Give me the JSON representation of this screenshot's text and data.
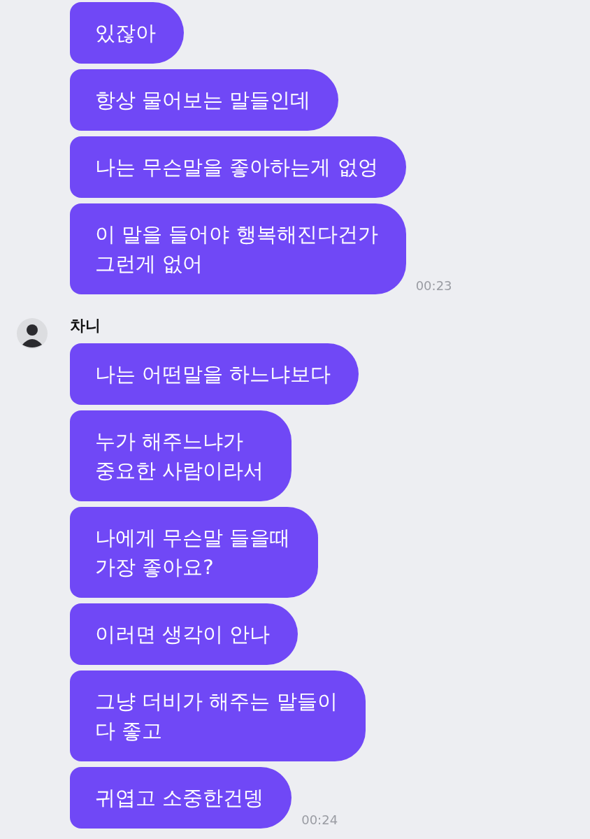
{
  "groups": [
    {
      "messages": [
        "있잖아",
        "항상 물어보는 말들인데",
        "나는 무슨말을 좋아하는게 없엉",
        "이 말을 들어야 행복해진다건가\n그런게 없어"
      ],
      "time": "00:23"
    },
    {
      "sender": {
        "name": "차니"
      },
      "messages": [
        "나는 어떤말을 하느냐보다",
        "누가 해주느냐가\n중요한 사람이라서",
        "나에게 무슨말 들을때\n가장 좋아요?",
        "이러면 생각이 안나",
        "그냥 더비가 해주는 말들이\n다 좋고",
        "귀엽고 소중한건뎅"
      ],
      "time": "00:24"
    }
  ]
}
